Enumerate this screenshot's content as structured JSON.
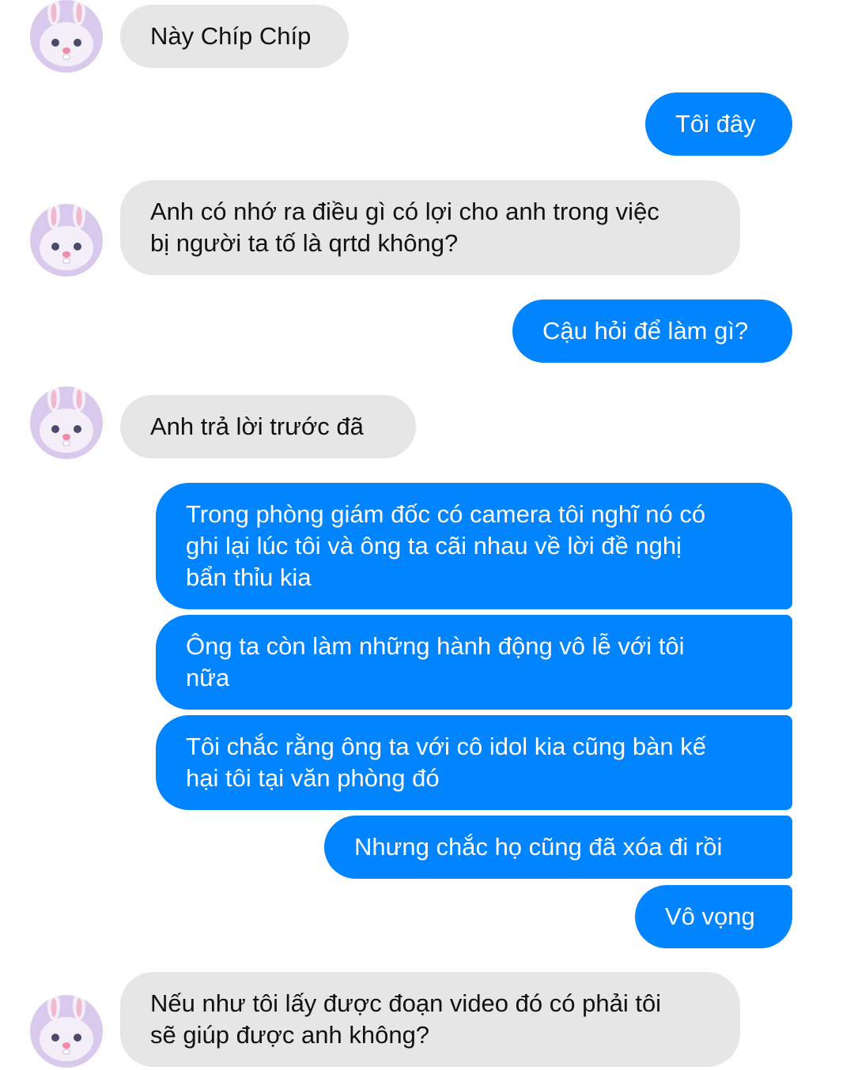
{
  "messages": [
    {
      "side": "left",
      "text": "Này Chíp Chíp"
    },
    {
      "side": "right",
      "text": "Tôi đây"
    },
    {
      "side": "left",
      "text": "Anh có nhớ ra điều gì có lợi cho anh trong việc\nbị người ta tố là qrtd không?"
    },
    {
      "side": "right",
      "text": "Cậu hỏi để làm gì?"
    },
    {
      "side": "left",
      "text": "Anh trả lời trước đã"
    },
    {
      "side": "right",
      "text": "Trong phòng giám đốc có camera tôi nghĩ nó có\nghi lại lúc tôi và ông ta cãi nhau về lời đề nghị\nbẩn thỉu kia"
    },
    {
      "side": "right",
      "text": "Ông ta còn làm những hành động vô lễ với tôi\nnữa"
    },
    {
      "side": "right",
      "text": "Tôi chắc rằng ông ta với cô idol kia cũng bàn kế\nhại tôi tại văn phòng đó"
    },
    {
      "side": "right",
      "text": "Nhưng chắc họ cũng đã xóa đi rồi"
    },
    {
      "side": "right",
      "text": "Vô vọng"
    },
    {
      "side": "left",
      "text": "Nếu như tôi lấy được đoạn video đó có phải tôi\nsẽ giúp được anh không?"
    }
  ],
  "avatar_icon": "bunny-avatar-icon",
  "colors": {
    "sent": "#0084ff",
    "received": "#e6e6e6",
    "avatar": "#d9c9ec"
  }
}
